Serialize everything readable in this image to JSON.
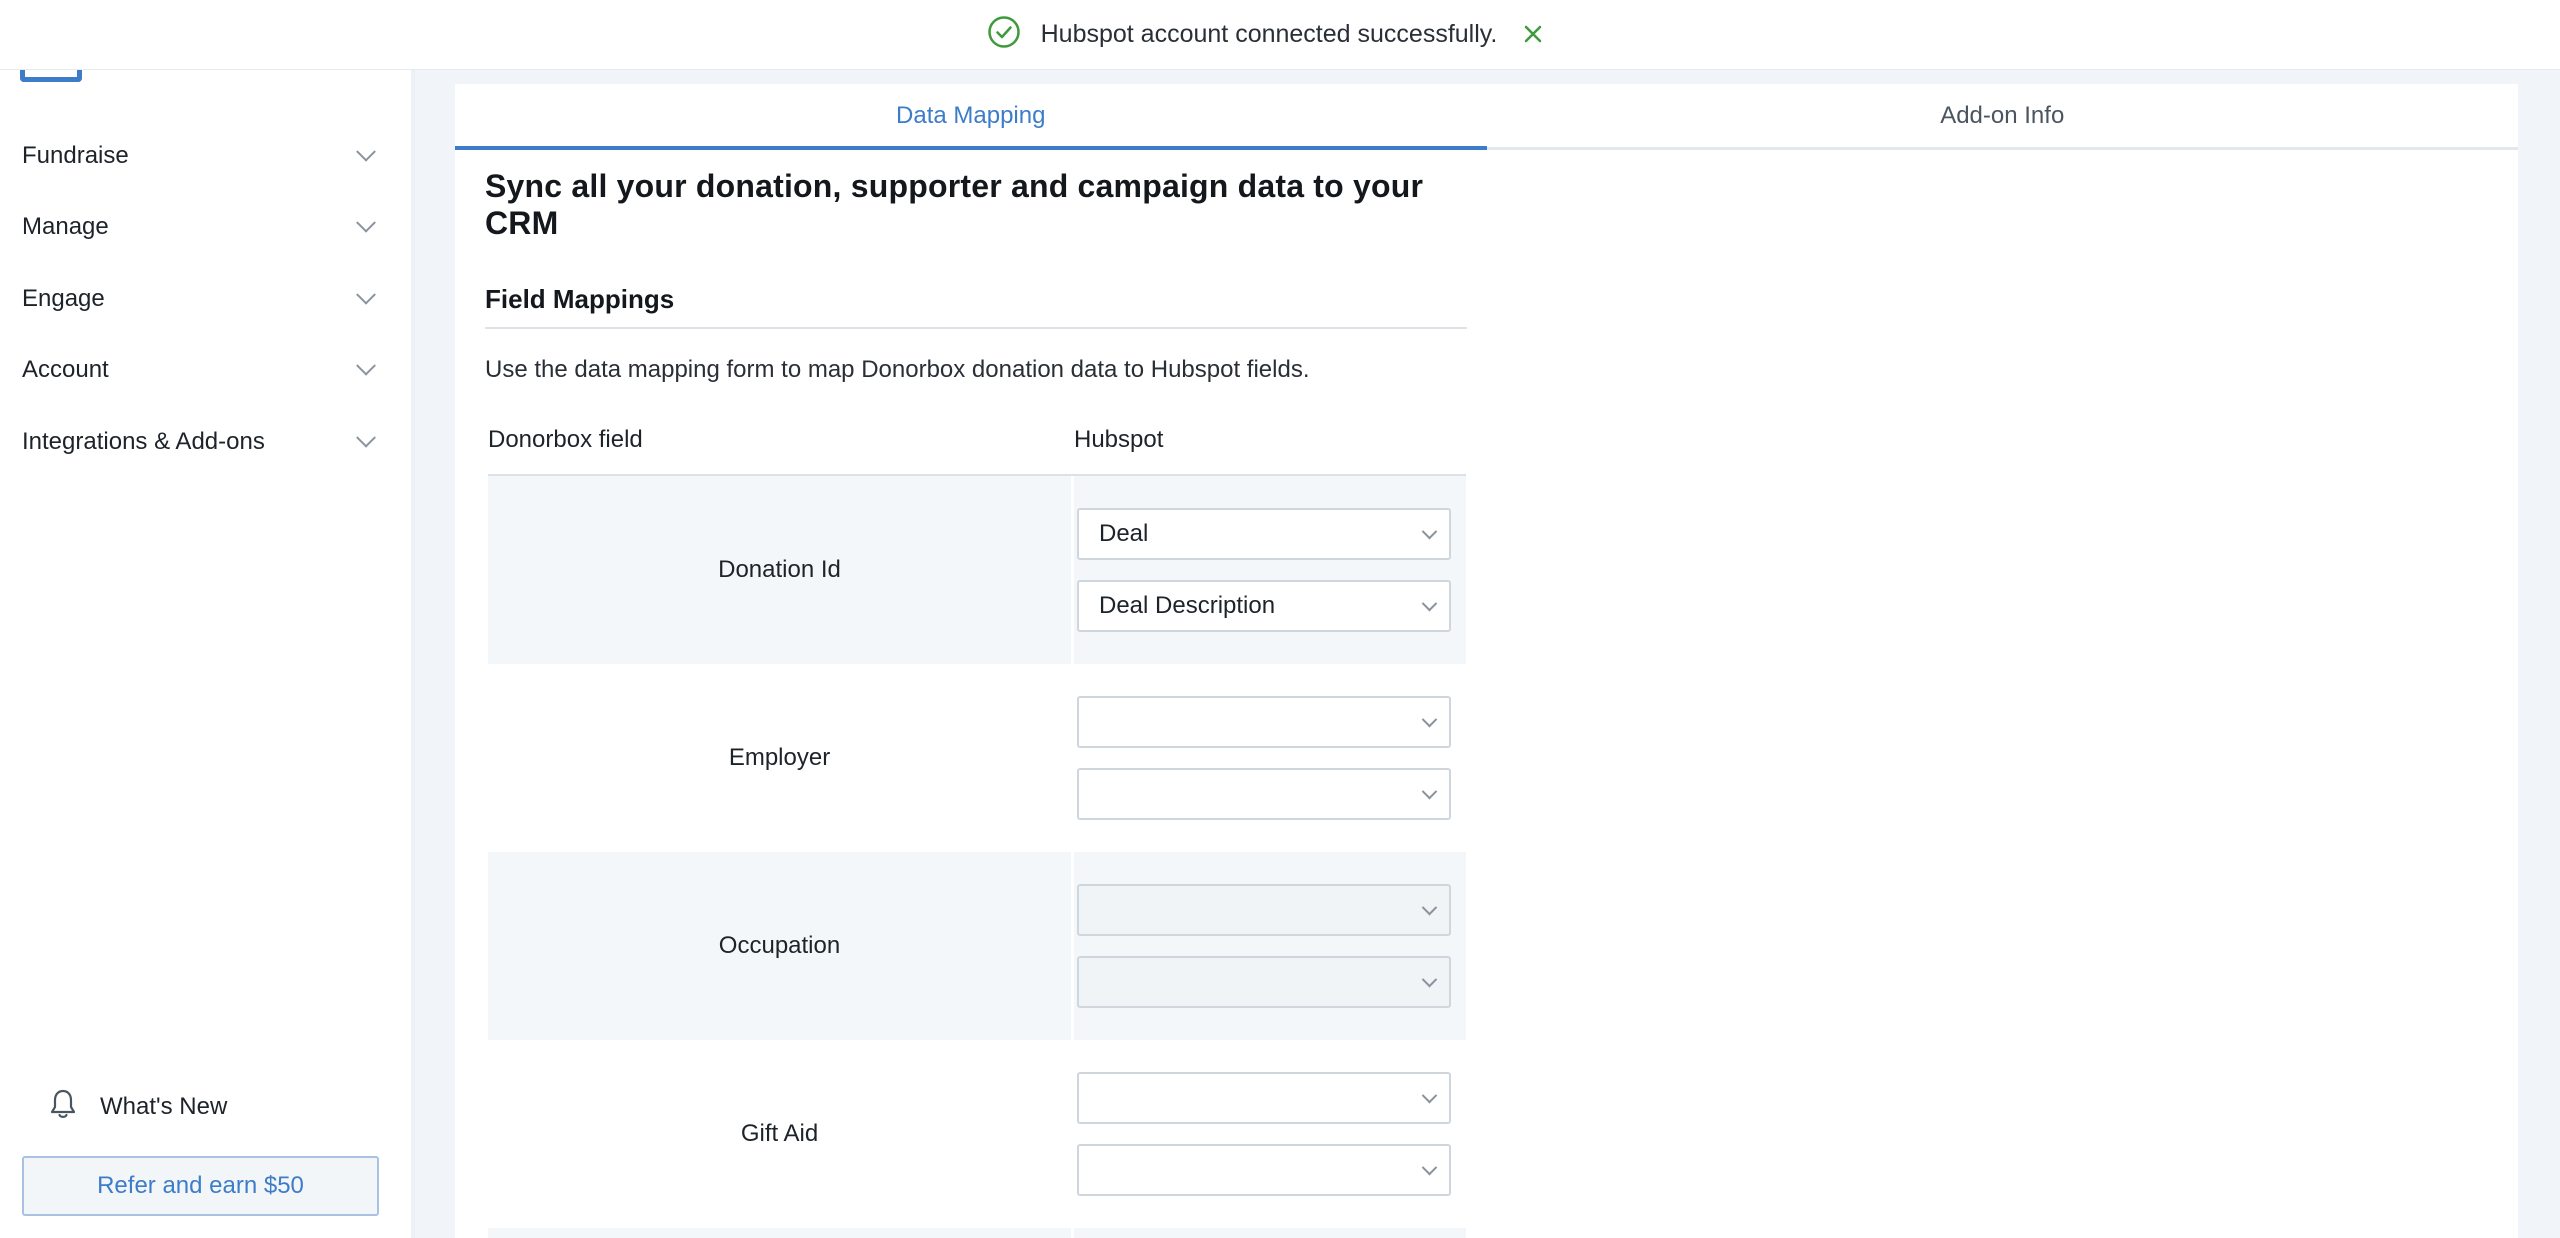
{
  "toast": {
    "icon": "check-circle-icon",
    "message": "Hubspot account connected successfully.",
    "close_icon": "close-icon",
    "color": "#3f9a3b"
  },
  "sidebar": {
    "items": [
      {
        "label": "Fundraise",
        "icon": "chevron-down-icon"
      },
      {
        "label": "Manage",
        "icon": "chevron-down-icon"
      },
      {
        "label": "Engage",
        "icon": "chevron-down-icon"
      },
      {
        "label": "Account",
        "icon": "chevron-down-icon"
      },
      {
        "label": "Integrations & Add-ons",
        "icon": "chevron-down-icon"
      }
    ],
    "whats_new": {
      "label": "What's New",
      "icon": "bell-icon"
    },
    "refer_button": "Refer and earn $50"
  },
  "tabs": [
    {
      "label": "Data Mapping",
      "active": true
    },
    {
      "label": "Add-on Info",
      "active": false
    }
  ],
  "main": {
    "heading": "Sync all your donation, supporter and campaign data to your CRM",
    "section_title": "Field Mappings",
    "description": "Use the data mapping form to map Donorbox donation data to Hubspot fields.",
    "table": {
      "headers": [
        "Donorbox field",
        "Hubspot"
      ],
      "rows": [
        {
          "field": "Donation Id",
          "object": "Deal",
          "property": "Deal Description"
        },
        {
          "field": "Employer",
          "object": "",
          "property": ""
        },
        {
          "field": "Occupation",
          "object": "",
          "property": ""
        },
        {
          "field": "Gift Aid",
          "object": "",
          "property": ""
        }
      ]
    }
  },
  "colors": {
    "accent": "#3d7cc9",
    "success": "#3f9a3b",
    "row_shade": "#f4f7fa"
  }
}
